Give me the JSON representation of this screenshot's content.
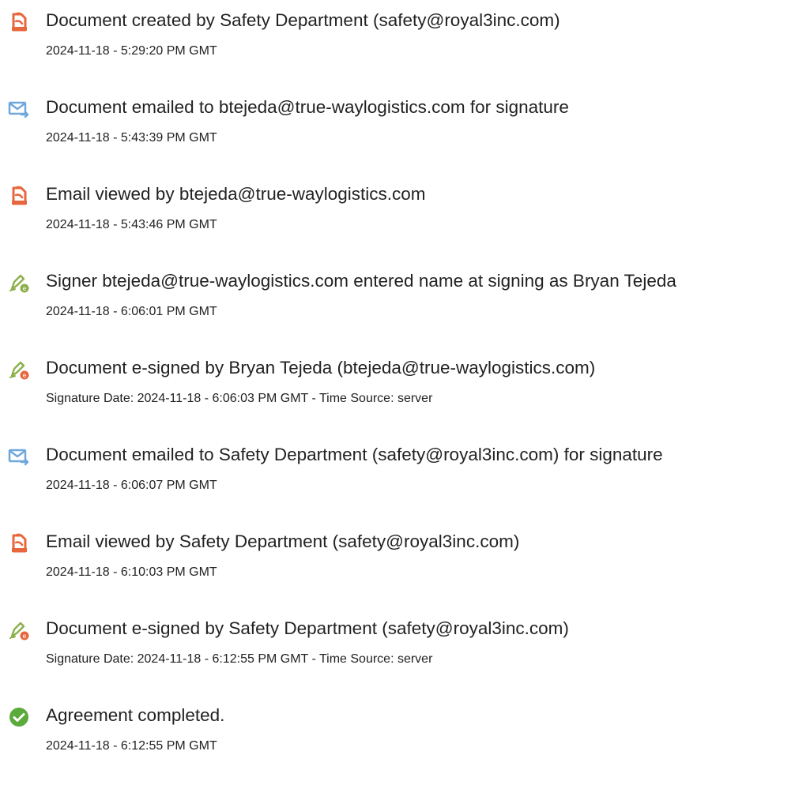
{
  "events": [
    {
      "icon": "document-created-icon",
      "title": "Document created by Safety Department (safety@royal3inc.com)",
      "meta": "2024-11-18 - 5:29:20 PM GMT"
    },
    {
      "icon": "document-emailed-icon",
      "title": "Document emailed to btejeda@true-waylogistics.com for signature",
      "meta": "2024-11-18 - 5:43:39 PM GMT"
    },
    {
      "icon": "document-viewed-icon",
      "title": "Email viewed by btejeda@true-waylogistics.com",
      "meta": "2024-11-18 - 5:43:46 PM GMT"
    },
    {
      "icon": "e-signature-icon",
      "title": "Signer btejeda@true-waylogistics.com entered name at signing as Bryan Tejeda",
      "meta": "2024-11-18 - 6:06:01 PM GMT"
    },
    {
      "icon": "e-signature-icon",
      "title": "Document e-signed by Bryan Tejeda (btejeda@true-waylogistics.com)",
      "meta": "Signature Date: 2024-11-18 - 6:06:03 PM GMT - Time Source: server"
    },
    {
      "icon": "document-emailed-icon",
      "title": "Document emailed to Safety Department (safety@royal3inc.com) for signature",
      "meta": "2024-11-18 - 6:06:07 PM GMT"
    },
    {
      "icon": "document-viewed-icon",
      "title": "Email viewed by Safety Department (safety@royal3inc.com)",
      "meta": "2024-11-18 - 6:10:03 PM GMT"
    },
    {
      "icon": "e-signature-icon",
      "title": "Document e-signed by Safety Department (safety@royal3inc.com)",
      "meta": "Signature Date: 2024-11-18 - 6:12:55 PM GMT - Time Source: server"
    },
    {
      "icon": "agreement-completed-icon",
      "title": "Agreement completed.",
      "meta": "2024-11-18 - 6:12:55 PM GMT"
    }
  ],
  "colors": {
    "document_icon": "#E8663D",
    "email_icon": "#6FA8DC",
    "signature_icon": "#8BB04A",
    "complete_icon": "#5BAA3C",
    "text": "#222222"
  }
}
